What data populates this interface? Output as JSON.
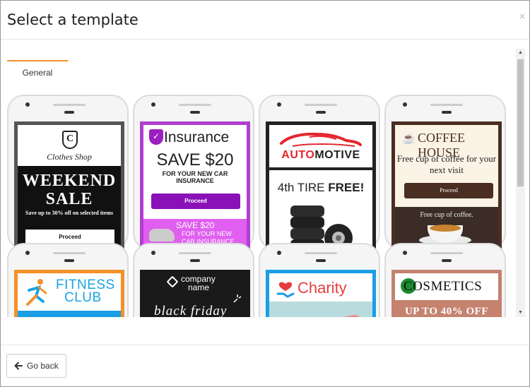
{
  "dialog": {
    "title": "Select a template",
    "close_glyph": "×"
  },
  "tabs": [
    {
      "label": "General",
      "active": true
    }
  ],
  "templates": [
    {
      "name": "Clothes Shop",
      "brand": "Clothes Shop",
      "shield_letter": "C",
      "headline_1": "WEEKEND",
      "headline_2": "SALE",
      "subtext": "Save up to 30% off on selected items",
      "button": "Proceed"
    },
    {
      "name": "Insurance",
      "brand": "Insurance",
      "headline": "SAVE $20",
      "subtext": "FOR YOUR NEW CAR INSURANCE",
      "button": "Proceed",
      "banner_1": "SAVE $20",
      "banner_2": "FOR YOUR NEW CAR INSURANCE"
    },
    {
      "name": "Automotive",
      "brand_red": "AUTO",
      "brand_dark": "MOTIVE",
      "headline_prefix": "4th TIRE ",
      "headline_bold": "FREE!"
    },
    {
      "name": "Coffee House",
      "brand": "COFFEE HOUSE",
      "headline": "Free cup of coffee for your next visit",
      "button": "Proceed",
      "photo_caption": "Free cup of coffee."
    },
    {
      "name": "Fitness Club",
      "brand_1": "FITNESS",
      "brand_2": "CLUB"
    },
    {
      "name": "Black Friday",
      "brand_1": "company",
      "brand_2": "name",
      "headline": "black friday"
    },
    {
      "name": "Charity",
      "brand": "Charity"
    },
    {
      "name": "Cosmetics",
      "brand": "COSMETICS",
      "headline": "UP TO 40% OFF"
    }
  ],
  "footer": {
    "back_label": "Go back"
  },
  "colors": {
    "tab_accent": "#f6912a",
    "insurance_purple": "#8a11b7",
    "automotive_red": "#e3262e",
    "coffee_brown": "#4a2e22",
    "fitness_blue": "#1aa3e0",
    "charity_red": "#e43d3d",
    "cosmetics_rose": "#c4826f"
  },
  "icons": {
    "close": "close-icon",
    "back": "arrow-left-icon",
    "scroll_up": "caret-up-icon",
    "scroll_down": "caret-down-icon"
  }
}
